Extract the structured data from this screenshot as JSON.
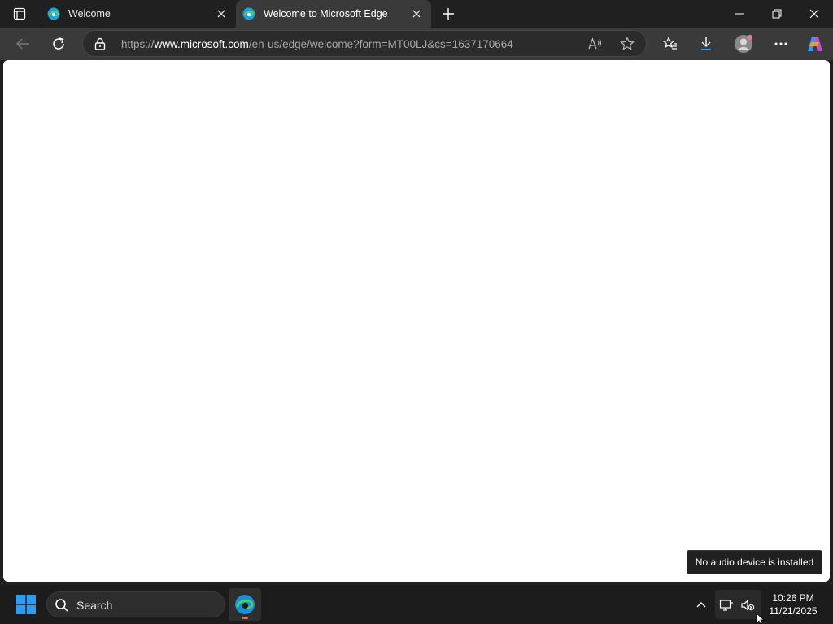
{
  "tabs": [
    {
      "title": "Welcome",
      "active": false,
      "icon": "edge-icon"
    },
    {
      "title": "Welcome to Microsoft Edge",
      "active": true,
      "icon": "edge-icon"
    }
  ],
  "address_bar": {
    "url_prefix": "https://",
    "url_host": "www.microsoft.com",
    "url_path": "/en-us/edge/welcome?form=MT00LJ&cs=1637170664"
  },
  "toast": {
    "text": "No audio device is installed"
  },
  "taskbar": {
    "search_placeholder": "Search",
    "time": "10:26 PM",
    "date": "11/21/2025"
  },
  "colors": {
    "titlebar": "#202020",
    "toolbar": "#3a3a3a",
    "content": "#ffffff",
    "taskbar": "#1c1c1c",
    "accent_windows": "#2f9cf2"
  }
}
